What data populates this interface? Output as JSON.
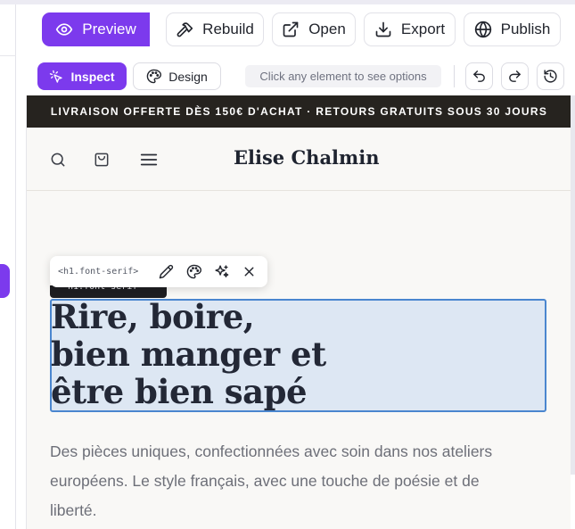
{
  "toolbar": {
    "preview_label": "Preview",
    "rebuild_label": "Rebuild",
    "open_label": "Open",
    "export_label": "Export",
    "publish_label": "Publish"
  },
  "mode_bar": {
    "inspect_label": "Inspect",
    "design_label": "Design",
    "hint": "Click any element to see options"
  },
  "colors": {
    "accent": "#7c3aed",
    "promo_bg": "#26231f",
    "selection_border": "#4a86cf",
    "selection_fill": "#dde7f3"
  },
  "site": {
    "promo_text": "LIVRAISON OFFERTE DÈS 150€ D'ACHAT · RETOURS GRATUITS SOUS 30 JOURS",
    "brand": "Elise Chalmin",
    "hero_lines": [
      "Rire, boire,",
      "bien manger et",
      "être bien sapé"
    ],
    "hero_sub": "Des pièces uniques, confectionnées avec soin dans nos ateliers européens. Le style français, avec une touche de poésie et de liberté."
  },
  "selection": {
    "tag": "<h1.font-serif>",
    "label": "h1.font-serif"
  },
  "icons": {
    "preview": "eye-icon",
    "rebuild": "hammer-icon",
    "open": "external-link-icon",
    "export": "download-icon",
    "publish": "globe-icon",
    "inspect": "sparkle-cursor-icon",
    "design": "palette-icon",
    "undo": "undo-icon",
    "redo": "redo-icon",
    "history": "history-icon"
  }
}
